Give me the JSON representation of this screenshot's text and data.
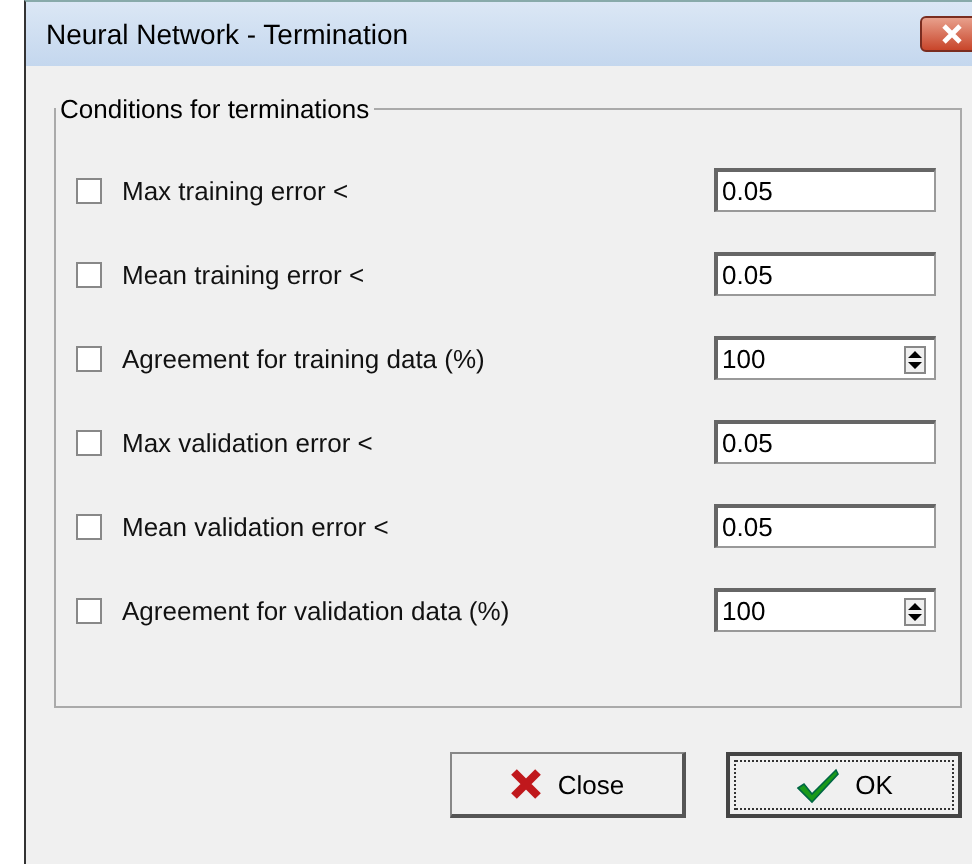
{
  "window": {
    "title": "Neural Network - Termination"
  },
  "group": {
    "title": "Conditions for terminations"
  },
  "conditions": [
    {
      "label": "Max training error <",
      "checked": false,
      "kind": "text",
      "value": "0.05"
    },
    {
      "label": "Mean training error <",
      "checked": false,
      "kind": "text",
      "value": "0.05"
    },
    {
      "label": "Agreement for training data (%)",
      "checked": false,
      "kind": "spin",
      "value": "100"
    },
    {
      "label": "Max validation error <",
      "checked": false,
      "kind": "text",
      "value": "0.05"
    },
    {
      "label": "Mean validation error <",
      "checked": false,
      "kind": "text",
      "value": "0.05"
    },
    {
      "label": "Agreement for validation data (%)",
      "checked": false,
      "kind": "spin",
      "value": "100"
    }
  ],
  "buttons": [
    {
      "label": "Close",
      "kind": "close",
      "focused": false
    },
    {
      "label": "OK",
      "kind": "ok",
      "focused": true
    }
  ]
}
